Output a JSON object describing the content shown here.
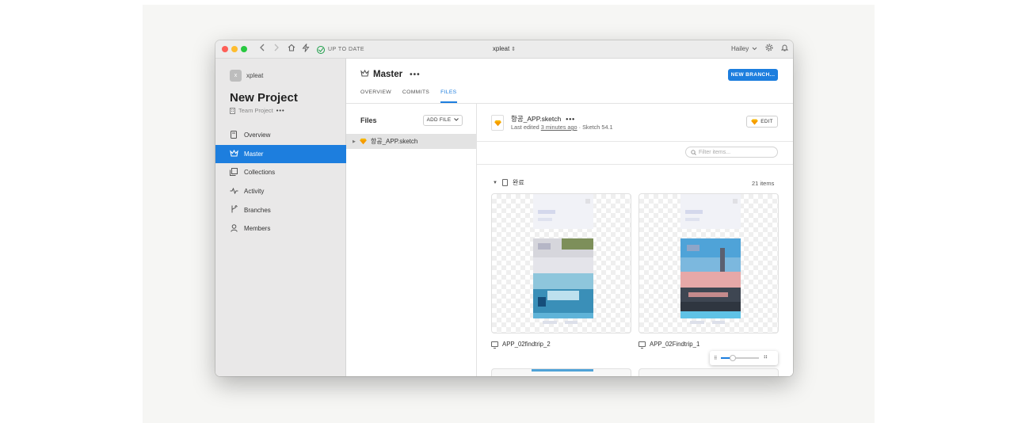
{
  "titlebar": {
    "status": "UP TO DATE",
    "window_title": "xpleat",
    "title_arrows": "⌃⌄",
    "user": "Hailey"
  },
  "sidebar": {
    "org_avatar": "x",
    "org_name": "xpleat",
    "project_title": "New Project",
    "project_type": "Team Project",
    "project_more": "•••",
    "items": [
      {
        "label": "Overview",
        "icon": "document-icon",
        "active": false
      },
      {
        "label": "Master",
        "icon": "crown-icon",
        "active": true
      },
      {
        "label": "Collections",
        "icon": "collections-icon",
        "active": false
      },
      {
        "label": "Activity",
        "icon": "activity-icon",
        "active": false
      },
      {
        "label": "Branches",
        "icon": "branch-icon",
        "active": false
      },
      {
        "label": "Members",
        "icon": "person-icon",
        "active": false
      }
    ]
  },
  "main": {
    "branch_name": "Master",
    "branch_more": "•••",
    "new_branch_label": "NEW BRANCH...",
    "tabs": [
      {
        "label": "OVERVIEW",
        "active": false
      },
      {
        "label": "COMMITS",
        "active": false
      },
      {
        "label": "FILES",
        "active": true
      }
    ]
  },
  "files": {
    "title": "Files",
    "add_file_label": "ADD FILE",
    "selected_file": "항공_APP.sketch"
  },
  "detail": {
    "file_name": "항공_APP.sketch",
    "more": "•••",
    "meta_prefix": "Last edited ",
    "meta_ago": "3 minutes ago",
    "meta_suffix": " · Sketch 54.1",
    "edit_label": "EDIT",
    "filter_placeholder": "Filter items...",
    "group_name": "완료",
    "item_count": "21 items",
    "artboards": [
      {
        "name": "APP_02findtrip_2"
      },
      {
        "name": "APP_02Findtrip_1"
      }
    ],
    "zoom_level": 0.3
  },
  "colors": {
    "accent": "#1d7ede",
    "sidebar_bg": "#e9e8e8",
    "status_green": "#1e9e4a",
    "sketch_gem": "#f7b500"
  }
}
